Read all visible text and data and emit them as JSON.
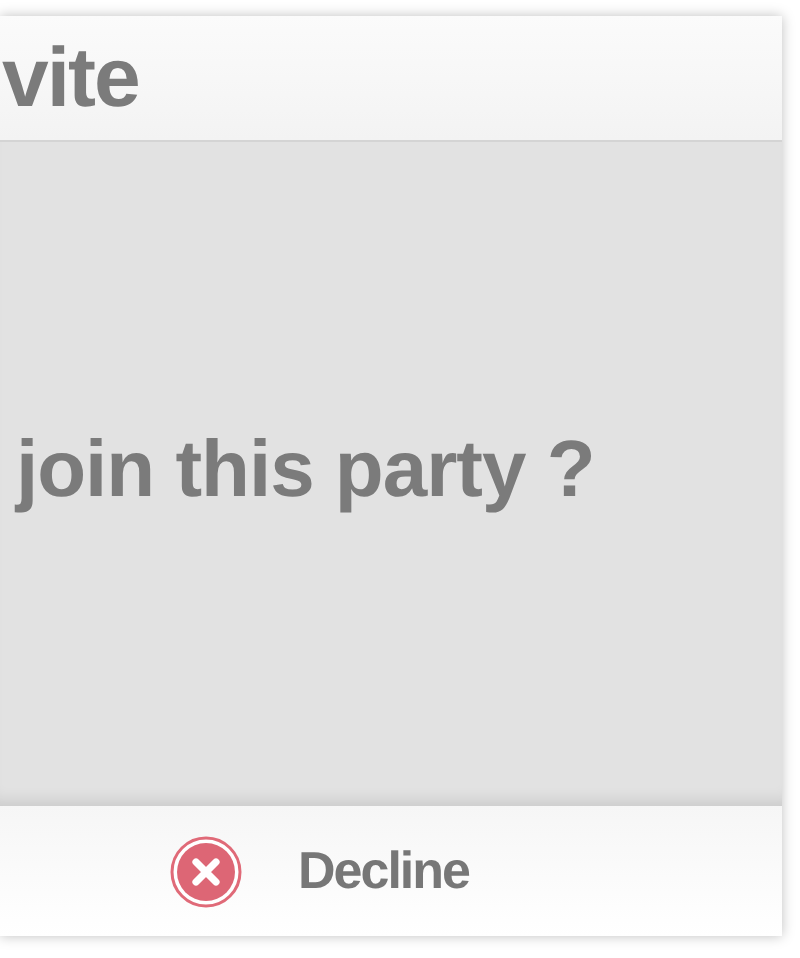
{
  "dialog": {
    "title": "vite",
    "message": "join this party ?",
    "buttons": [
      {
        "kind": "decline",
        "label": "Decline"
      }
    ]
  }
}
